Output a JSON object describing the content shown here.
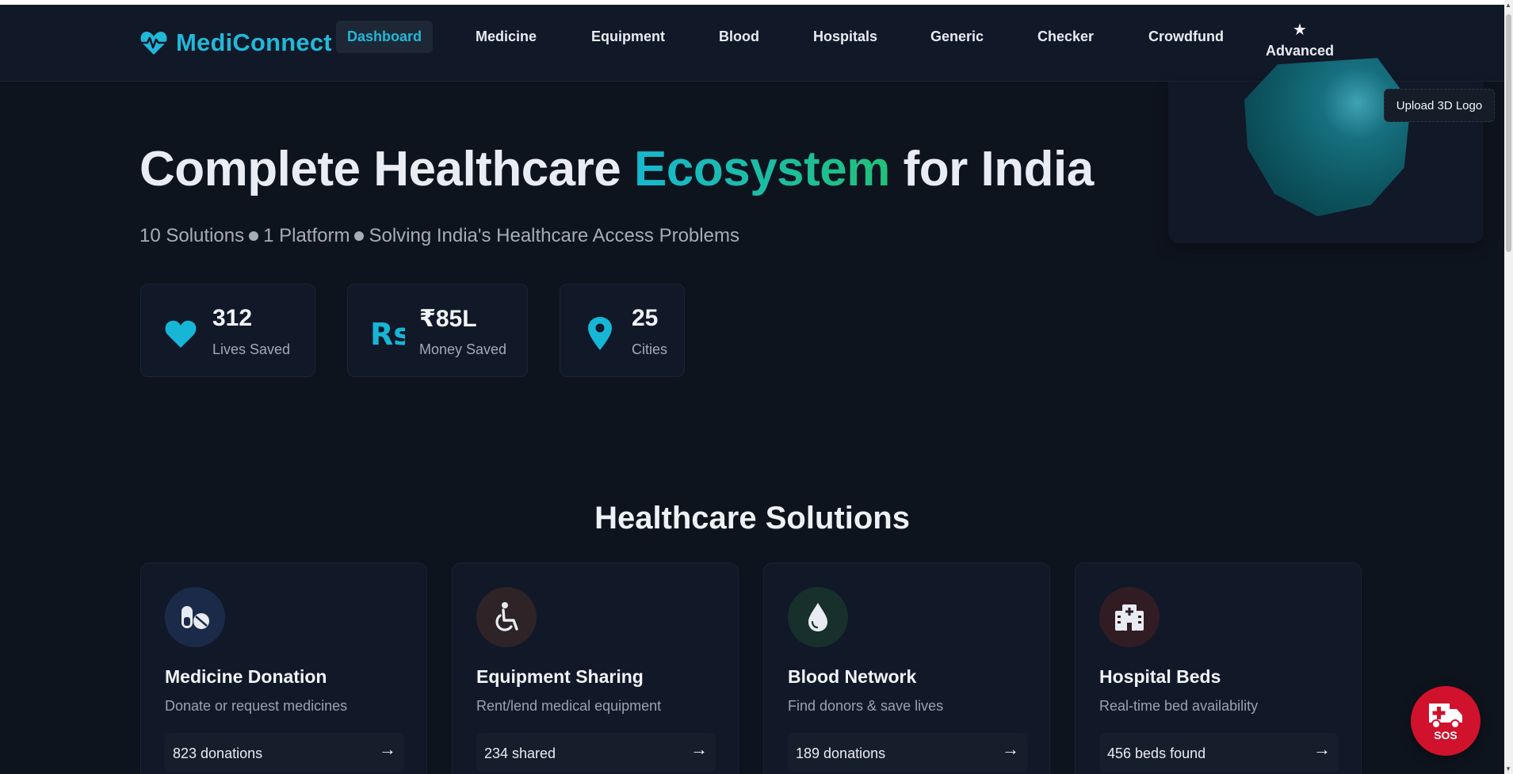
{
  "brand": {
    "name": "MediConnect",
    "color": "#22b8d8"
  },
  "nav": {
    "items": [
      {
        "label": "Dashboard",
        "active": true
      },
      {
        "label": "Medicine"
      },
      {
        "label": "Equipment"
      },
      {
        "label": "Blood"
      },
      {
        "label": "Hospitals"
      },
      {
        "label": "Generic"
      },
      {
        "label": "Checker"
      },
      {
        "label": "Crowdfund"
      }
    ],
    "advanced": {
      "label": "Advanced",
      "icon": "star-icon"
    }
  },
  "logo_panel": {
    "upload_label": "Upload 3D Logo"
  },
  "hero": {
    "title_pre": "Complete Healthcare ",
    "title_accent": "Ecosystem",
    "title_post": " for India",
    "subtitle_parts": [
      "10 Solutions",
      "1 Platform",
      "Solving India's Healthcare Access Problems"
    ]
  },
  "stats": [
    {
      "value": "312",
      "label": "Lives Saved",
      "icon": "heart-icon"
    },
    {
      "value": "₹85L",
      "label": "Money Saved",
      "icon": "rupee-icon"
    },
    {
      "value": "25",
      "label": "Cities",
      "icon": "map-pin-icon"
    }
  ],
  "solutions": {
    "title": "Healthcare Solutions",
    "cards": [
      {
        "title": "Medicine Donation",
        "desc": "Donate or request medicines",
        "stat": "823 donations",
        "icon": "pills-icon"
      },
      {
        "title": "Equipment Sharing",
        "desc": "Rent/lend medical equipment",
        "stat": "234 shared",
        "icon": "wheelchair-icon"
      },
      {
        "title": "Blood Network",
        "desc": "Find donors & save lives",
        "stat": "189 donations",
        "icon": "blood-drop-icon"
      },
      {
        "title": "Hospital Beds",
        "desc": "Real-time bed availability",
        "stat": "456 beds found",
        "icon": "hospital-icon"
      }
    ]
  },
  "sos": {
    "label": "SOS",
    "icon": "ambulance-icon",
    "color": "#d0122c"
  }
}
